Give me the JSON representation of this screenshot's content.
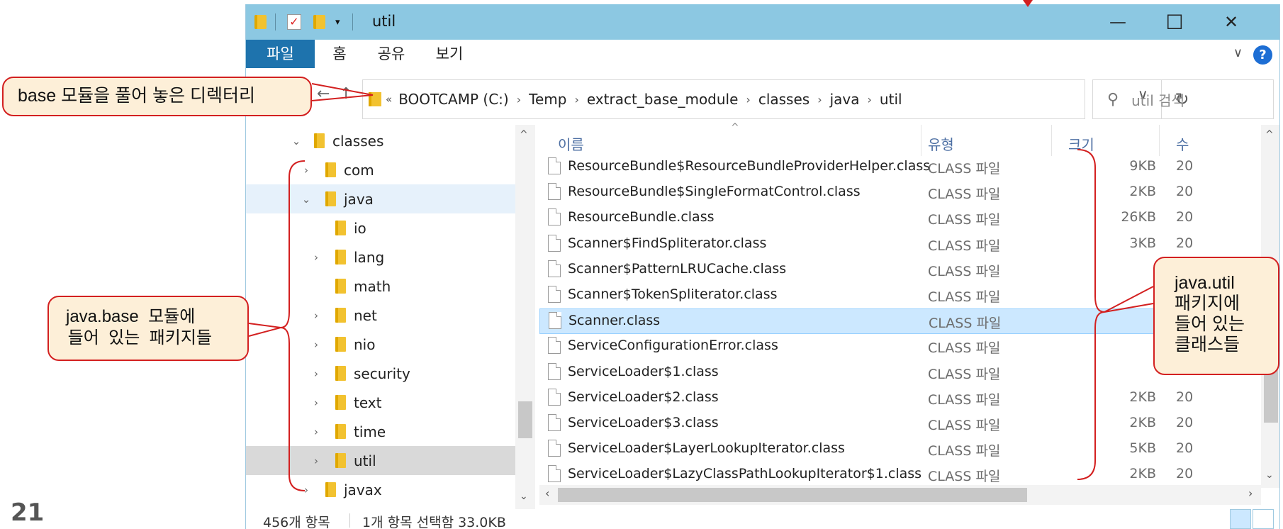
{
  "slide": {
    "number": "21"
  },
  "window": {
    "title": "util",
    "min_glyph": "—",
    "max_glyph": "☐",
    "close_glyph": "✕"
  },
  "quick_access": {
    "dropdown_glyph": "▾"
  },
  "ribbon": {
    "tabs": [
      "파일",
      "홈",
      "공유",
      "보기"
    ],
    "collapse_glyph": "∨",
    "help_glyph": "?"
  },
  "nav": {
    "back_glyph": "←",
    "up_glyph": "↑",
    "overflow_glyph": "«",
    "breadcrumbs": [
      "BOOTCAMP (C:)",
      "Temp",
      "extract_base_module",
      "classes",
      "java",
      "util"
    ],
    "separator_glyph": "›",
    "dropdown_glyph": "∨",
    "refresh_glyph": "↻",
    "search_placeholder": "util 검색",
    "search_icon_glyph": "⚲"
  },
  "tree": {
    "expanded_glyph": "⌄",
    "collapsed_glyph": "›",
    "nodes": [
      {
        "label": "classes",
        "depth": 0,
        "state": "expanded"
      },
      {
        "label": "com",
        "depth": 1,
        "state": "collapsed"
      },
      {
        "label": "java",
        "depth": 1,
        "state": "expanded"
      },
      {
        "label": "io",
        "depth": 2,
        "state": "none"
      },
      {
        "label": "lang",
        "depth": 2,
        "state": "collapsed"
      },
      {
        "label": "math",
        "depth": 2,
        "state": "none"
      },
      {
        "label": "net",
        "depth": 2,
        "state": "collapsed"
      },
      {
        "label": "nio",
        "depth": 2,
        "state": "collapsed"
      },
      {
        "label": "security",
        "depth": 2,
        "state": "collapsed"
      },
      {
        "label": "text",
        "depth": 2,
        "state": "collapsed"
      },
      {
        "label": "time",
        "depth": 2,
        "state": "collapsed"
      },
      {
        "label": "util",
        "depth": 2,
        "state": "collapsed"
      },
      {
        "label": "javax",
        "depth": 1,
        "state": "collapsed"
      }
    ],
    "selected": "util",
    "hover": "java"
  },
  "file_list": {
    "columns": {
      "name": "이름",
      "type": "유형",
      "size": "크기",
      "date": "수"
    },
    "sort_glyph": "^",
    "files": [
      {
        "name": "ResourceBundle$ResourceBundleProviderHelper.class",
        "type": "CLASS 파일",
        "size": "9KB",
        "date": "20"
      },
      {
        "name": "ResourceBundle$SingleFormatControl.class",
        "type": "CLASS 파일",
        "size": "2KB",
        "date": "20"
      },
      {
        "name": "ResourceBundle.class",
        "type": "CLASS 파일",
        "size": "26KB",
        "date": "20"
      },
      {
        "name": "Scanner$FindSpliterator.class",
        "type": "CLASS 파일",
        "size": "3KB",
        "date": "20"
      },
      {
        "name": "Scanner$PatternLRUCache.class",
        "type": "CLASS 파일",
        "size": "",
        "date": ""
      },
      {
        "name": "Scanner$TokenSpliterator.class",
        "type": "CLASS 파일",
        "size": "",
        "date": ""
      },
      {
        "name": "Scanner.class",
        "type": "CLASS 파일",
        "size": "",
        "date": ""
      },
      {
        "name": "ServiceConfigurationError.class",
        "type": "CLASS 파일",
        "size": "",
        "date": ""
      },
      {
        "name": "ServiceLoader$1.class",
        "type": "CLASS 파일",
        "size": "",
        "date": ""
      },
      {
        "name": "ServiceLoader$2.class",
        "type": "CLASS 파일",
        "size": "2KB",
        "date": "20"
      },
      {
        "name": "ServiceLoader$3.class",
        "type": "CLASS 파일",
        "size": "2KB",
        "date": "20"
      },
      {
        "name": "ServiceLoader$LayerLookupIterator.class",
        "type": "CLASS 파일",
        "size": "5KB",
        "date": "20"
      },
      {
        "name": "ServiceLoader$LazyClassPathLookupIterator$1.class",
        "type": "CLASS 파일",
        "size": "2KB",
        "date": "20"
      }
    ],
    "selected_file": "Scanner.class"
  },
  "scroll": {
    "up": "^",
    "down": "⌄",
    "left": "‹",
    "right": "›"
  },
  "status": {
    "item_count": "456개 항목",
    "selection": "1개 항목 선택함 33.0KB"
  },
  "annotations": {
    "base_dir": "base 모듈을 풀어 놓은 디렉터리",
    "packages_line1": "java.base  모듈에",
    "packages_line2": " 들어  있는  패키지들",
    "util_line1": "java.util",
    "util_line2": "패키지에",
    "util_line3": "들어 있는",
    "util_line4": "클래스들",
    "color": "#d32020",
    "fill": "#fdefd8"
  },
  "colors": {
    "titlebar": "#8cc8e2",
    "file_tab": "#1e73ad",
    "selection": "#cce8ff",
    "tree_hover": "#e6f1fb",
    "tree_selected": "#d9d9d9",
    "folder": "#f2c230"
  }
}
